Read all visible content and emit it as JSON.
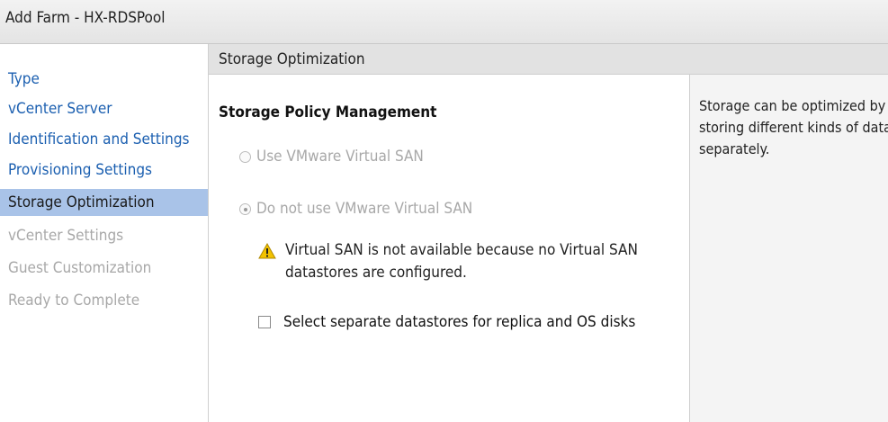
{
  "window": {
    "title": "Add Farm - HX-RDSPool"
  },
  "sidebar": {
    "items": [
      {
        "label": "Type",
        "state": "link"
      },
      {
        "label": "vCenter Server",
        "state": "link"
      },
      {
        "label": "Identification and Settings",
        "state": "link"
      },
      {
        "label": "Provisioning Settings",
        "state": "link"
      },
      {
        "label": "Storage Optimization",
        "state": "active"
      },
      {
        "label": "vCenter Settings",
        "state": "disabled"
      },
      {
        "label": "Guest Customization",
        "state": "disabled"
      },
      {
        "label": "Ready to Complete",
        "state": "disabled"
      }
    ]
  },
  "main": {
    "header": "Storage Optimization",
    "section_title": "Storage Policy Management",
    "options": [
      {
        "label": "Use VMware Virtual SAN",
        "selected": false,
        "enabled": false
      },
      {
        "label": "Do not use VMware Virtual SAN",
        "selected": true,
        "enabled": false
      }
    ],
    "warning": "Virtual SAN is not available because no Virtual SAN datastores are configured.",
    "checkbox": {
      "label": "Select separate datastores for replica and OS disks",
      "checked": false
    }
  },
  "help": {
    "text": "Storage can be optimized by storing different kinds of data separately."
  },
  "colors": {
    "nav_link": "#1b5fb0",
    "nav_active_bg": "#a9c3e8",
    "disabled_text": "#a8a8a8",
    "warning_icon": "#f2c200"
  }
}
